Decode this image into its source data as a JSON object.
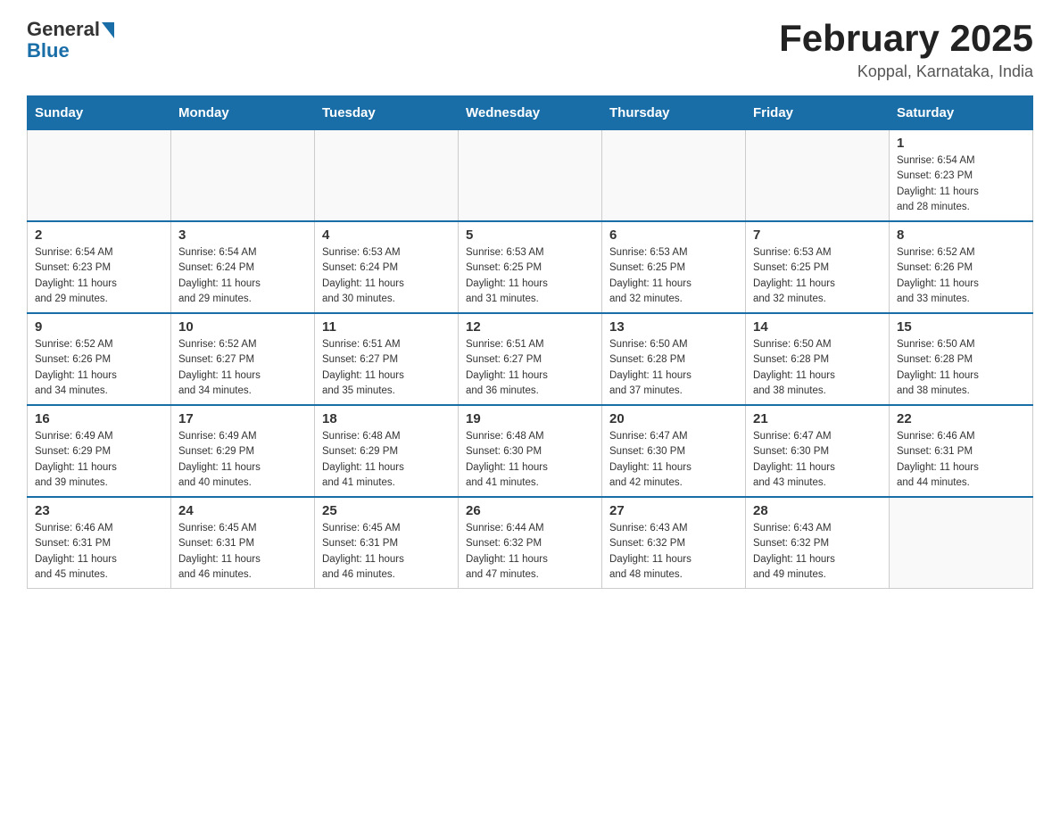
{
  "header": {
    "logo_general": "General",
    "logo_blue": "Blue",
    "title": "February 2025",
    "subtitle": "Koppal, Karnataka, India"
  },
  "days_of_week": [
    "Sunday",
    "Monday",
    "Tuesday",
    "Wednesday",
    "Thursday",
    "Friday",
    "Saturday"
  ],
  "weeks": [
    {
      "days": [
        {
          "num": "",
          "info": ""
        },
        {
          "num": "",
          "info": ""
        },
        {
          "num": "",
          "info": ""
        },
        {
          "num": "",
          "info": ""
        },
        {
          "num": "",
          "info": ""
        },
        {
          "num": "",
          "info": ""
        },
        {
          "num": "1",
          "info": "Sunrise: 6:54 AM\nSunset: 6:23 PM\nDaylight: 11 hours\nand 28 minutes."
        }
      ]
    },
    {
      "days": [
        {
          "num": "2",
          "info": "Sunrise: 6:54 AM\nSunset: 6:23 PM\nDaylight: 11 hours\nand 29 minutes."
        },
        {
          "num": "3",
          "info": "Sunrise: 6:54 AM\nSunset: 6:24 PM\nDaylight: 11 hours\nand 29 minutes."
        },
        {
          "num": "4",
          "info": "Sunrise: 6:53 AM\nSunset: 6:24 PM\nDaylight: 11 hours\nand 30 minutes."
        },
        {
          "num": "5",
          "info": "Sunrise: 6:53 AM\nSunset: 6:25 PM\nDaylight: 11 hours\nand 31 minutes."
        },
        {
          "num": "6",
          "info": "Sunrise: 6:53 AM\nSunset: 6:25 PM\nDaylight: 11 hours\nand 32 minutes."
        },
        {
          "num": "7",
          "info": "Sunrise: 6:53 AM\nSunset: 6:25 PM\nDaylight: 11 hours\nand 32 minutes."
        },
        {
          "num": "8",
          "info": "Sunrise: 6:52 AM\nSunset: 6:26 PM\nDaylight: 11 hours\nand 33 minutes."
        }
      ]
    },
    {
      "days": [
        {
          "num": "9",
          "info": "Sunrise: 6:52 AM\nSunset: 6:26 PM\nDaylight: 11 hours\nand 34 minutes."
        },
        {
          "num": "10",
          "info": "Sunrise: 6:52 AM\nSunset: 6:27 PM\nDaylight: 11 hours\nand 34 minutes."
        },
        {
          "num": "11",
          "info": "Sunrise: 6:51 AM\nSunset: 6:27 PM\nDaylight: 11 hours\nand 35 minutes."
        },
        {
          "num": "12",
          "info": "Sunrise: 6:51 AM\nSunset: 6:27 PM\nDaylight: 11 hours\nand 36 minutes."
        },
        {
          "num": "13",
          "info": "Sunrise: 6:50 AM\nSunset: 6:28 PM\nDaylight: 11 hours\nand 37 minutes."
        },
        {
          "num": "14",
          "info": "Sunrise: 6:50 AM\nSunset: 6:28 PM\nDaylight: 11 hours\nand 38 minutes."
        },
        {
          "num": "15",
          "info": "Sunrise: 6:50 AM\nSunset: 6:28 PM\nDaylight: 11 hours\nand 38 minutes."
        }
      ]
    },
    {
      "days": [
        {
          "num": "16",
          "info": "Sunrise: 6:49 AM\nSunset: 6:29 PM\nDaylight: 11 hours\nand 39 minutes."
        },
        {
          "num": "17",
          "info": "Sunrise: 6:49 AM\nSunset: 6:29 PM\nDaylight: 11 hours\nand 40 minutes."
        },
        {
          "num": "18",
          "info": "Sunrise: 6:48 AM\nSunset: 6:29 PM\nDaylight: 11 hours\nand 41 minutes."
        },
        {
          "num": "19",
          "info": "Sunrise: 6:48 AM\nSunset: 6:30 PM\nDaylight: 11 hours\nand 41 minutes."
        },
        {
          "num": "20",
          "info": "Sunrise: 6:47 AM\nSunset: 6:30 PM\nDaylight: 11 hours\nand 42 minutes."
        },
        {
          "num": "21",
          "info": "Sunrise: 6:47 AM\nSunset: 6:30 PM\nDaylight: 11 hours\nand 43 minutes."
        },
        {
          "num": "22",
          "info": "Sunrise: 6:46 AM\nSunset: 6:31 PM\nDaylight: 11 hours\nand 44 minutes."
        }
      ]
    },
    {
      "days": [
        {
          "num": "23",
          "info": "Sunrise: 6:46 AM\nSunset: 6:31 PM\nDaylight: 11 hours\nand 45 minutes."
        },
        {
          "num": "24",
          "info": "Sunrise: 6:45 AM\nSunset: 6:31 PM\nDaylight: 11 hours\nand 46 minutes."
        },
        {
          "num": "25",
          "info": "Sunrise: 6:45 AM\nSunset: 6:31 PM\nDaylight: 11 hours\nand 46 minutes."
        },
        {
          "num": "26",
          "info": "Sunrise: 6:44 AM\nSunset: 6:32 PM\nDaylight: 11 hours\nand 47 minutes."
        },
        {
          "num": "27",
          "info": "Sunrise: 6:43 AM\nSunset: 6:32 PM\nDaylight: 11 hours\nand 48 minutes."
        },
        {
          "num": "28",
          "info": "Sunrise: 6:43 AM\nSunset: 6:32 PM\nDaylight: 11 hours\nand 49 minutes."
        },
        {
          "num": "",
          "info": ""
        }
      ]
    }
  ]
}
